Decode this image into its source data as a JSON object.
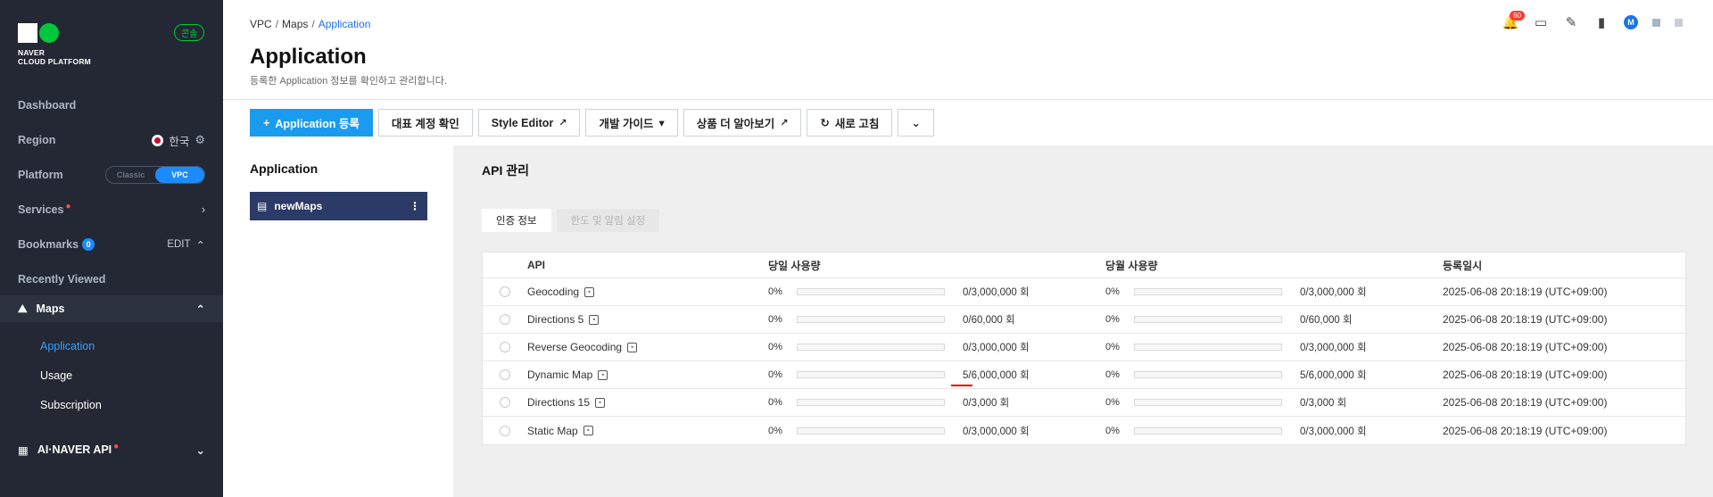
{
  "sidebar": {
    "logo_line1": "NAVER",
    "logo_line2": "CLOUD PLATFORM",
    "console_badge": "콘솔",
    "dashboard": "Dashboard",
    "region_label": "Region",
    "region_value": "한국",
    "platform_label": "Platform",
    "platform_classic": "Classic",
    "platform_vpc": "VPC",
    "services": "Services",
    "bookmarks": "Bookmarks",
    "bookmarks_count": "0",
    "bookmarks_edit": "EDIT",
    "recently_viewed": "Recently Viewed",
    "maps": "Maps",
    "maps_sub": [
      "Application",
      "Usage",
      "Subscription"
    ],
    "ai_naver_api": "AI·NAVER API"
  },
  "header": {
    "breadcrumb": [
      "VPC",
      "Maps",
      "Application"
    ],
    "title": "Application",
    "subtitle": "등록한 Application 정보를 확인하고 관리합니다.",
    "notification_count": "60",
    "avatar_letter": "M"
  },
  "toolbar": {
    "register": "Application 등록",
    "check_account": "대표 계정 확인",
    "style_editor": "Style Editor",
    "dev_guide": "개발 가이드",
    "more_products": "상품 더 알아보기",
    "refresh": "새로 고침"
  },
  "app_panel": {
    "title": "Application",
    "item": "newMaps"
  },
  "api_panel": {
    "title": "API 관리",
    "tab_auth": "인증 정보",
    "tab_limit": "한도 및 알림 설정",
    "columns": [
      "API",
      "당일 사용량",
      "당월 사용량",
      "등록일시"
    ],
    "rows": [
      {
        "api": "Geocoding",
        "day_pct": "0%",
        "day_pct_value": 0,
        "day_limit": "0/3,000,000 회",
        "month_pct": "0%",
        "month_pct_value": 0,
        "month_limit": "0/3,000,000 회",
        "date": "2025-06-08 20:18:19 (UTC+09:00)"
      },
      {
        "api": "Directions 5",
        "day_pct": "0%",
        "day_pct_value": 0,
        "day_limit": "0/60,000 회",
        "month_pct": "0%",
        "month_pct_value": 0,
        "month_limit": "0/60,000 회",
        "date": "2025-06-08 20:18:19 (UTC+09:00)"
      },
      {
        "api": "Reverse Geocoding",
        "day_pct": "0%",
        "day_pct_value": 0,
        "day_limit": "0/3,000,000 회",
        "month_pct": "0%",
        "month_pct_value": 0,
        "month_limit": "0/3,000,000 회",
        "date": "2025-06-08 20:18:19 (UTC+09:00)"
      },
      {
        "api": "Dynamic Map",
        "day_pct": "0%",
        "day_pct_value": 0,
        "day_limit": "5/6,000,000 회",
        "month_pct": "0%",
        "month_pct_value": 0,
        "month_limit": "5/6,000,000 회",
        "date": "2025-06-08 20:18:19 (UTC+09:00)"
      },
      {
        "api": "Directions 15",
        "day_pct": "0%",
        "day_pct_value": 0,
        "day_limit": "0/3,000 회",
        "month_pct": "0%",
        "month_pct_value": 0,
        "month_limit": "0/3,000 회",
        "date": "2025-06-08 20:18:19 (UTC+09:00)"
      },
      {
        "api": "Static Map",
        "day_pct": "0%",
        "day_pct_value": 0,
        "day_limit": "0/3,000,000 회",
        "month_pct": "0%",
        "month_pct_value": 0,
        "month_limit": "0/3,000,000 회",
        "date": "2025-06-08 20:18:19 (UTC+09:00)"
      }
    ]
  },
  "colors": {
    "sidebar_bg": "#232834",
    "accent": "#1a9bf0",
    "app_item_bg": "#2b3a66",
    "brand_green": "#00c73c"
  }
}
